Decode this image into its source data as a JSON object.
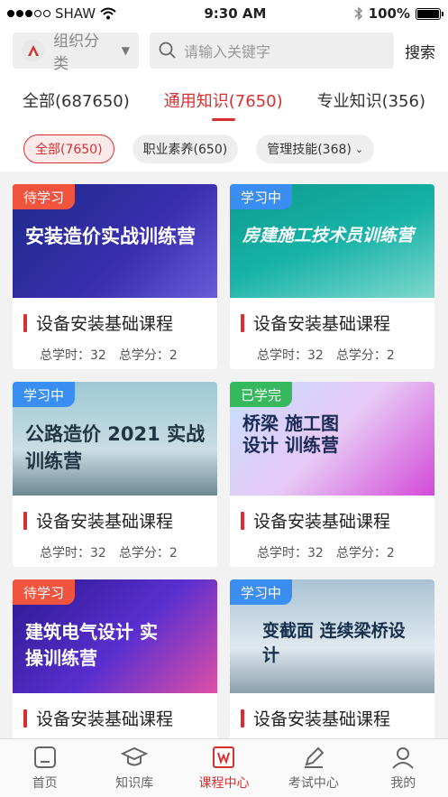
{
  "status": {
    "carrier": "SHAW",
    "time": "9:30 AM",
    "battery": "100%"
  },
  "search": {
    "category_label": "组织分类",
    "placeholder": "请输入关键字",
    "button": "搜索"
  },
  "tabs": [
    {
      "label": "全部(687650)"
    },
    {
      "label": "通用知识(7650)"
    },
    {
      "label": "专业知识(356)"
    }
  ],
  "chips": [
    {
      "label": "全部(7650)"
    },
    {
      "label": "职业素养(650)"
    },
    {
      "label": "管理技能(368)"
    }
  ],
  "courses": [
    {
      "badge": "待学习",
      "thumb_title": "安装造价实战训练营",
      "name": "设备安装基础课程",
      "hours": "总学时：32",
      "credits": "总学分：2"
    },
    {
      "badge": "学习中",
      "thumb_title": "房建施工技术员训练营",
      "name": "设备安装基础课程",
      "hours": "总学时：32",
      "credits": "总学分：2"
    },
    {
      "badge": "学习中",
      "thumb_title": "公路造价 2021 实战训练营",
      "name": "设备安装基础课程",
      "hours": "总学时：32",
      "credits": "总学分：2"
    },
    {
      "badge": "已学完",
      "thumb_title": "桥梁 施工图 设计 训练营",
      "name": "设备安装基础课程",
      "hours": "总学时：32",
      "credits": "总学分：2"
    },
    {
      "badge": "待学习",
      "thumb_title": "建筑电气设计 实操训练营",
      "name": "设备安装基础课程",
      "hours": "",
      "credits": ""
    },
    {
      "badge": "学习中",
      "thumb_title": "变截面 连续梁桥设计",
      "name": "设备安装基础课程",
      "hours": "",
      "credits": ""
    }
  ],
  "nav": [
    {
      "label": "首页",
      "icon": "home-icon"
    },
    {
      "label": "知识库",
      "icon": "graduation-cap-icon"
    },
    {
      "label": "课程中心",
      "icon": "course-icon"
    },
    {
      "label": "考试中心",
      "icon": "pen-icon"
    },
    {
      "label": "我的",
      "icon": "user-icon"
    }
  ],
  "colors": {
    "accent": "#d83030",
    "badge_red": "#f0533e",
    "badge_blue": "#3a8ef2",
    "badge_green": "#35b85e"
  }
}
